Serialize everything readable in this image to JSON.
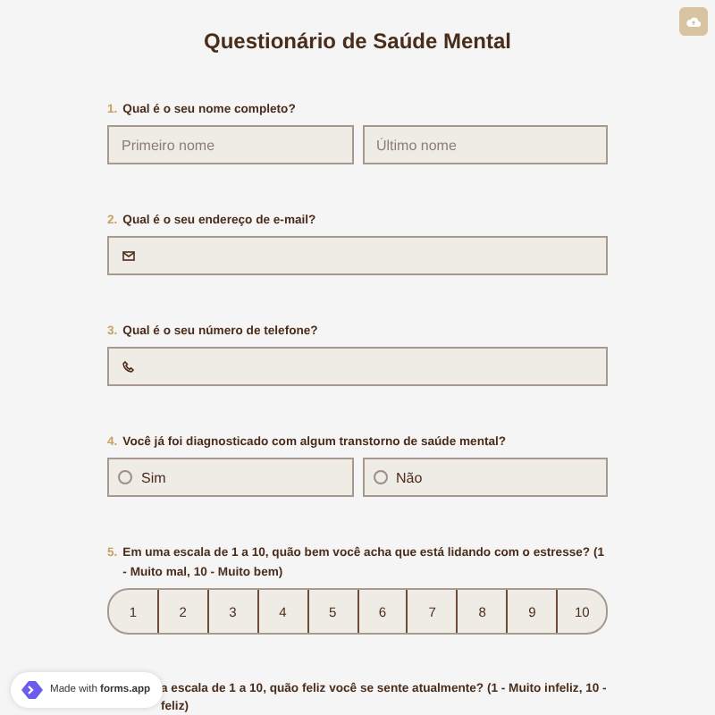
{
  "title": "Questionário de Saúde Mental",
  "questions": [
    {
      "number": "1.",
      "label": "Qual é o seu nome completo?",
      "kind": "name",
      "fields": [
        {
          "placeholder": "Primeiro nome"
        },
        {
          "placeholder": "Último nome"
        }
      ]
    },
    {
      "number": "2.",
      "label": "Qual é o seu endereço de e-mail?",
      "kind": "email"
    },
    {
      "number": "3.",
      "label": "Qual é o seu número de telefone?",
      "kind": "phone"
    },
    {
      "number": "4.",
      "label": "Você já foi diagnosticado com algum transtorno de saúde mental?",
      "kind": "choice",
      "options": [
        {
          "label": "Sim",
          "selected": false
        },
        {
          "label": "Não",
          "selected": false
        }
      ]
    },
    {
      "number": "5.",
      "label": "Em uma escala de 1 a 10, quão bem você acha que está lidando com o estresse? (1 - Muito mal, 10 - Muito bem)",
      "kind": "scale",
      "options": [
        {
          "label": "1",
          "selected": false
        },
        {
          "label": "2",
          "selected": false
        },
        {
          "label": "3",
          "selected": false
        },
        {
          "label": "4",
          "selected": false
        },
        {
          "label": "5",
          "selected": false
        },
        {
          "label": "6",
          "selected": false
        },
        {
          "label": "7",
          "selected": false
        },
        {
          "label": "8",
          "selected": false
        },
        {
          "label": "9",
          "selected": false
        },
        {
          "label": "10",
          "selected": false
        }
      ]
    },
    {
      "lines": [
        "a escala de 1 a 10, quão feliz você se sente atualmente? (1 - Muito infeliz, 10 -",
        "feliz)"
      ],
      "kind": "partial"
    }
  ],
  "badge": {
    "prefix": "Made with",
    "brand": "forms.app"
  }
}
